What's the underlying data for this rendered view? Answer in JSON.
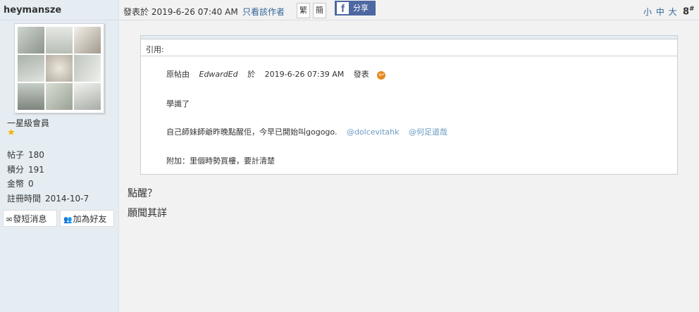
{
  "user": {
    "name": "heymansze",
    "rank": "一星級會員",
    "stats": [
      {
        "label": "帖子",
        "value": "180"
      },
      {
        "label": "積分",
        "value": "191"
      },
      {
        "label": "金幣",
        "value": "0"
      },
      {
        "label": "註冊時間",
        "value": "2014-10-7"
      }
    ],
    "pm_label": "發短消息",
    "friend_label": "加為好友"
  },
  "header": {
    "posted": "發表於 2019-6-26 07:40 AM",
    "only_author": "只看該作者",
    "trad": "繁",
    "simp": "簡",
    "share": "分享",
    "font_sizes": "小 中 大",
    "floor": "8",
    "floor_mark": "#"
  },
  "quote": {
    "label": "引用:",
    "meta_prefix": "原帖由",
    "author": "EdwardEd",
    "at": "於",
    "date": "2019-6-26 07:39 AM",
    "posted": "發表",
    "line1": "學識了",
    "line2": "自己師妹師爺昨晚點醒佢，今早已開始叫gogogo.",
    "mention1": "@dolcevitahk",
    "mention2": "@何足道哉",
    "line3": "附加：里個時勢買樓，要計清楚"
  },
  "reply": {
    "line1": "點醒？",
    "line2": "願聞其詳"
  },
  "colors": {
    "sidebar_bg": "#e5edf2",
    "link": "#336699",
    "mention": "#6a9ac4",
    "facebook": "#4c67a1"
  }
}
